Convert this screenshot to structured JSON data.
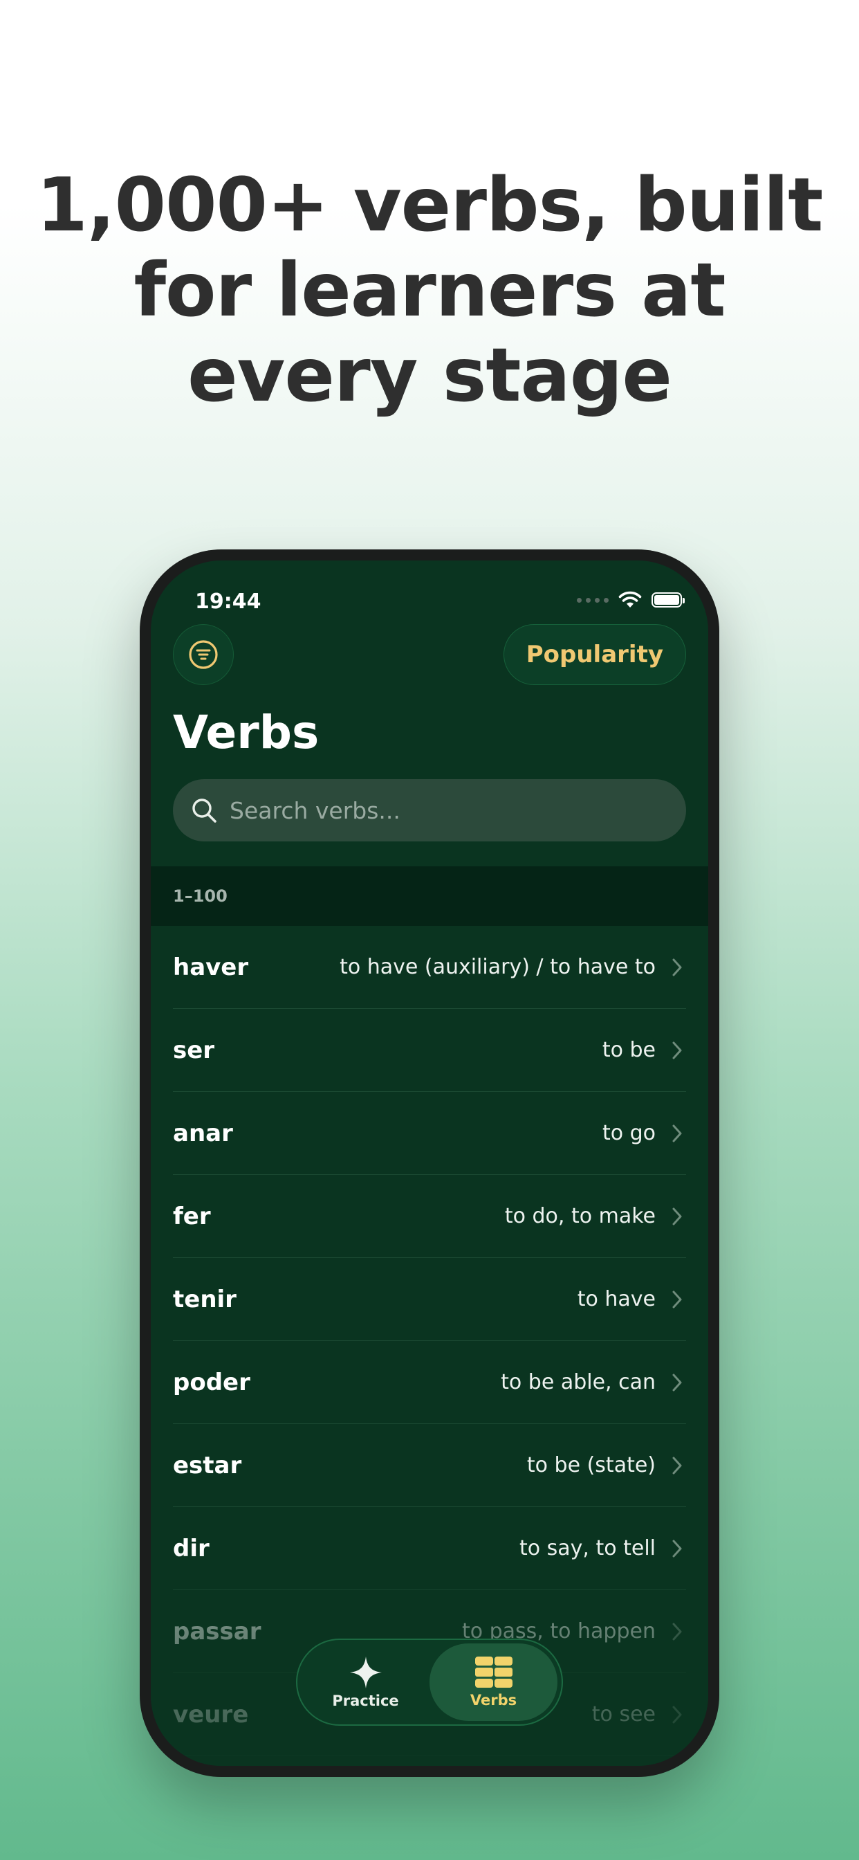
{
  "headline": {
    "lines": [
      "1,000+ verbs, built",
      "for learners at",
      "every stage"
    ]
  },
  "status_bar": {
    "time": "19:44"
  },
  "header": {
    "sort_label": "Popularity",
    "title": "Verbs"
  },
  "search": {
    "placeholder": "Search verbs..."
  },
  "section": {
    "label": "1–100"
  },
  "verbs": [
    {
      "verb": "haver",
      "meaning": "to have (auxiliary) / to have to"
    },
    {
      "verb": "ser",
      "meaning": "to be"
    },
    {
      "verb": "anar",
      "meaning": "to go"
    },
    {
      "verb": "fer",
      "meaning": "to do, to make"
    },
    {
      "verb": "tenir",
      "meaning": "to have"
    },
    {
      "verb": "poder",
      "meaning": "to be able, can"
    },
    {
      "verb": "estar",
      "meaning": "to be (state)"
    },
    {
      "verb": "dir",
      "meaning": "to say, to tell"
    },
    {
      "verb": "passar",
      "meaning": "to pass, to happen"
    },
    {
      "verb": "veure",
      "meaning": "to see"
    }
  ],
  "tabbar": {
    "tabs": [
      {
        "label": "Practice",
        "icon": "sparkle-icon",
        "active": false
      },
      {
        "label": "Verbs",
        "icon": "grid-icon",
        "active": true
      }
    ]
  },
  "colors": {
    "screen_bg": "#0a3420",
    "accent": "#f0c872",
    "active_tab_label": "#f2d36b"
  }
}
